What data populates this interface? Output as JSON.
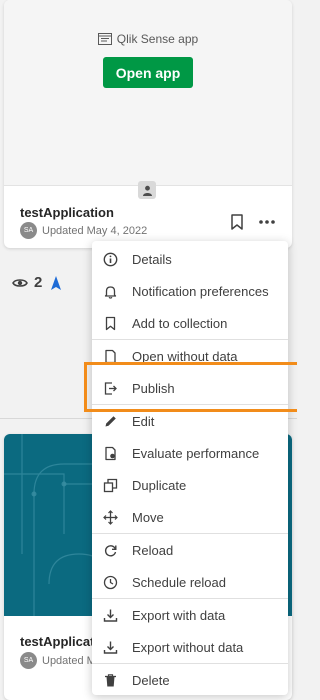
{
  "card1": {
    "app_type_label": "Qlik Sense app",
    "open_button": "Open app",
    "title": "testApplication",
    "avatar_initials": "SA",
    "updated": "Updated May 4, 2022"
  },
  "stats": {
    "views": "2"
  },
  "card2": {
    "title": "testApplicat",
    "avatar_initials": "SA",
    "updated": "Updated M"
  },
  "menu": {
    "details": "Details",
    "notification_preferences": "Notification preferences",
    "add_to_collection": "Add to collection",
    "open_without_data": "Open without data",
    "publish": "Publish",
    "edit": "Edit",
    "evaluate_performance": "Evaluate performance",
    "duplicate": "Duplicate",
    "move": "Move",
    "reload": "Reload",
    "schedule_reload": "Schedule reload",
    "export_with_data": "Export with data",
    "export_without_data": "Export without data",
    "delete": "Delete"
  },
  "colors": {
    "open_button_bg": "#009845",
    "highlight_border": "#f28c1a",
    "thumbnail_bg": "#0b6a80"
  }
}
